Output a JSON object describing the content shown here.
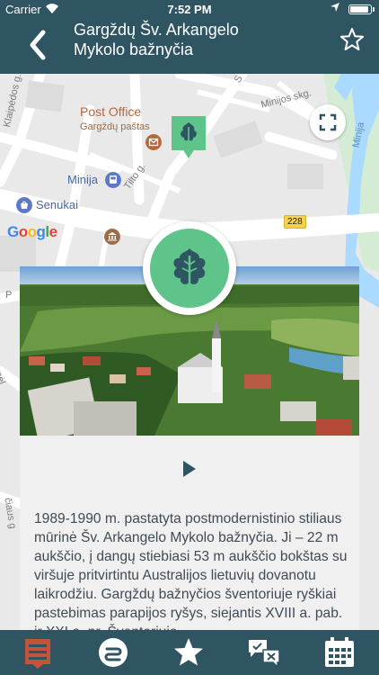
{
  "status_bar": {
    "carrier": "Carrier",
    "time": "7:52 PM"
  },
  "header": {
    "title_line1": "Gargždų Šv. Arkangelo",
    "title_line2": "Mykolo bažnyčia",
    "back_icon": "chevron-left-icon",
    "favorite_icon": "star-outline-icon"
  },
  "map": {
    "streets": [
      "Klaipėdos g.",
      "Minijos skg.",
      "Tilto g.",
      "Minija"
    ],
    "pois": {
      "post_office": "Post Office",
      "post_office_sub": "Gargždų paštas",
      "minija": "Minija",
      "senukai": "Senukai"
    },
    "road_number": "228",
    "google_logo": "Google",
    "edge_fragments": {
      "s_top": "S",
      "p_left": "P",
      "mel_left": "mėl",
      "cius_left": "čiaus g"
    }
  },
  "detail": {
    "play_icon": "play-icon",
    "description": "1989-1990 m. pastatyta postmodernistinio stiliaus mūrinė Šv. Arkangelo Mykolo bažnyčia. Ji – 22 m aukščio, į dangų stiebiasi 53 m aukščio bokštas su viršuje pritvirtintu Australijos lietuvių dovanotu laikrodžiu. Gargždų bažnyčios šventoriuje ryškiai pastebimas parapijos ryšys, siejantis XVIII a. pab. ir XXI a. pr. Šventoriuje"
  },
  "tab_bar": {
    "tabs": [
      {
        "icon": "list-icon",
        "active": true
      },
      {
        "icon": "route-icon",
        "active": false
      },
      {
        "icon": "star-icon",
        "active": false
      },
      {
        "icon": "chat-icon",
        "active": false
      },
      {
        "icon": "calendar-icon",
        "active": false
      }
    ]
  },
  "colors": {
    "header_bg": "#2f5563",
    "accent_green": "#5ec48a",
    "active_tab": "#c5533b"
  }
}
